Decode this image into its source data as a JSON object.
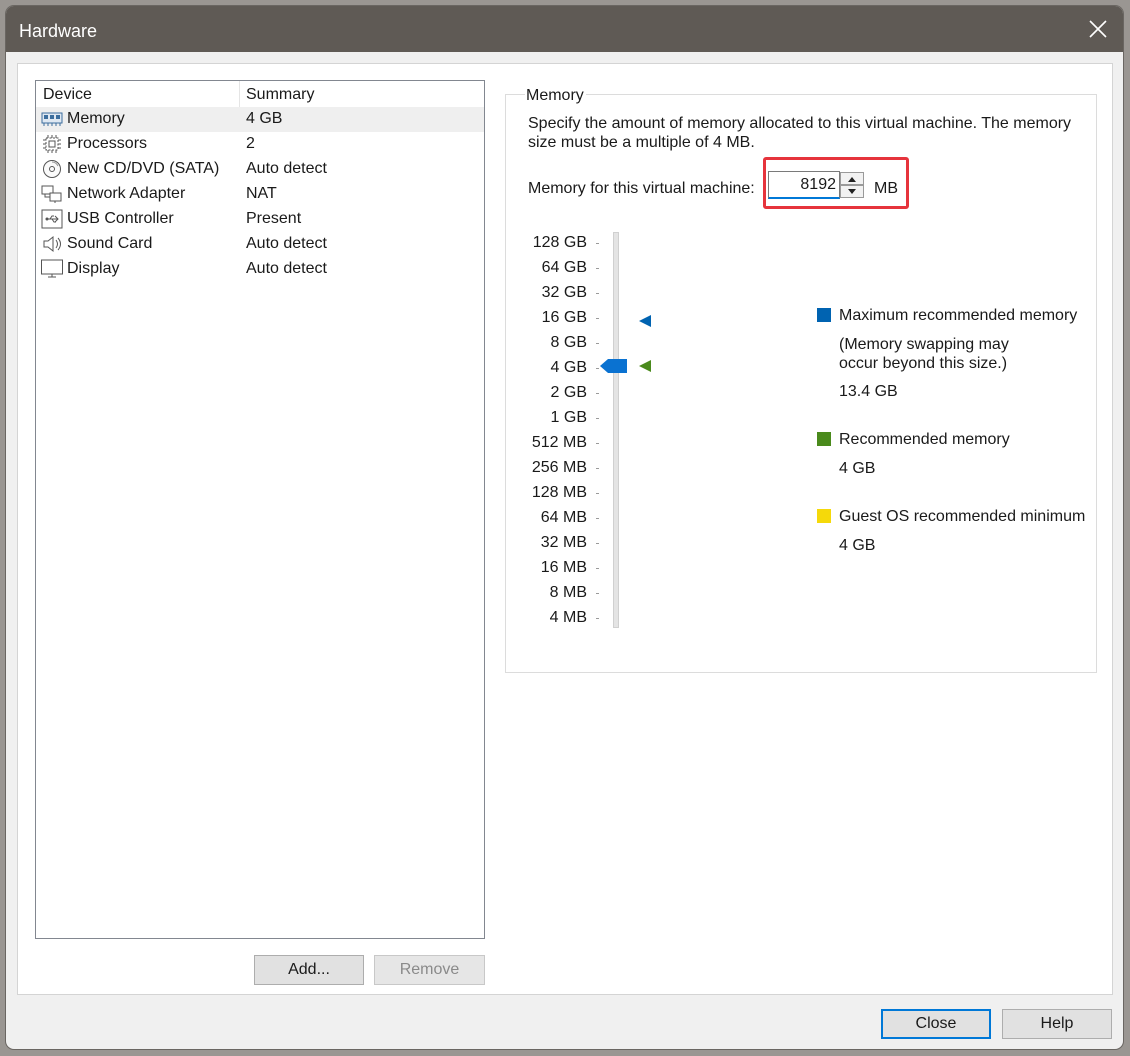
{
  "window": {
    "title": "Hardware"
  },
  "device_list": {
    "columns": {
      "device": "Device",
      "summary": "Summary"
    },
    "rows": [
      {
        "name": "Memory",
        "summary": "4 GB",
        "icon": "memory-icon",
        "selected": true
      },
      {
        "name": "Processors",
        "summary": "2",
        "icon": "processor-icon"
      },
      {
        "name": "New CD/DVD (SATA)",
        "summary": "Auto detect",
        "icon": "cd-dvd-icon"
      },
      {
        "name": "Network Adapter",
        "summary": "NAT",
        "icon": "network-adapter-icon"
      },
      {
        "name": "USB Controller",
        "summary": "Present",
        "icon": "usb-icon"
      },
      {
        "name": "Sound Card",
        "summary": "Auto detect",
        "icon": "speaker-icon"
      },
      {
        "name": "Display",
        "summary": "Auto detect",
        "icon": "monitor-icon"
      }
    ],
    "add_label": "Add...",
    "remove_label": "Remove"
  },
  "memory": {
    "group_title": "Memory",
    "description": "Specify the amount of memory allocated to this virtual machine. The memory size must be a multiple of 4 MB.",
    "field_label": "Memory for this virtual machine:",
    "value": "8192",
    "unit": "MB",
    "slider": {
      "ticks": [
        "128 GB",
        "64 GB",
        "32 GB",
        "16 GB",
        "8 GB",
        "4 GB",
        "2 GB",
        "1 GB",
        "512 MB",
        "256 MB",
        "128 MB",
        "64 MB",
        "32 MB",
        "16 MB",
        "8 MB",
        "4 MB"
      ],
      "thumb_at": "4 GB",
      "max_marker_at": "16 GB",
      "recommended_marker_at": "4 GB"
    },
    "legend": {
      "max": {
        "label": "Maximum recommended memory",
        "note_line1": "(Memory swapping may",
        "note_line2": "occur beyond this size.)",
        "value": "13.4 GB",
        "color": "#0063b1"
      },
      "recommended": {
        "label": "Recommended memory",
        "value": "4 GB",
        "color": "#4a8a1c"
      },
      "guest_min": {
        "label": "Guest OS recommended minimum",
        "value": "4 GB",
        "color": "#f5d90a"
      }
    }
  },
  "footer": {
    "close_label": "Close",
    "help_label": "Help"
  }
}
